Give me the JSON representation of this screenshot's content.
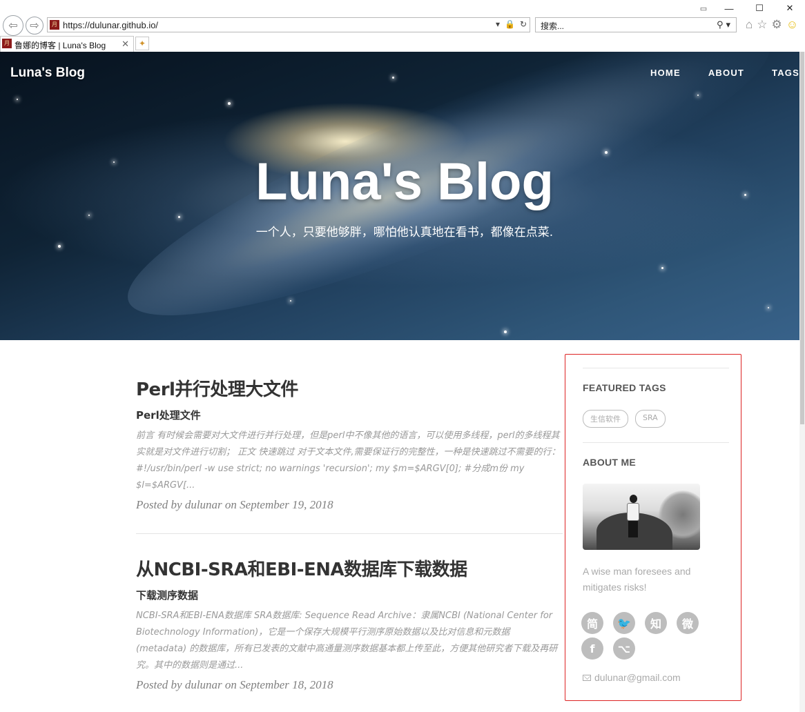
{
  "browser": {
    "url": "https://dulunar.github.io/",
    "search_placeholder": "搜索...",
    "tab_title": "鲁娜的博客 | Luna's Blog",
    "favicon_text": "月",
    "tab_close": "✕",
    "window_controls": {
      "minimize": "—",
      "maximize": "☐",
      "close": "✕"
    },
    "icons": [
      "back-icon",
      "forward-icon",
      "lock-icon",
      "refresh-icon",
      "search-icon",
      "home-icon",
      "star-icon",
      "gear-icon",
      "smiley-icon"
    ]
  },
  "header": {
    "brand": "Luna's Blog",
    "nav": [
      "HOME",
      "ABOUT",
      "TAGS"
    ],
    "title": "Luna's Blog",
    "subtitle": "一个人，只要他够胖，哪怕他认真地在看书，都像在点菜."
  },
  "posts": [
    {
      "title": "Perl并行处理大文件",
      "subtitle": "Perl处理文件",
      "excerpt": "前言 有时候会需要对大文件进行并行处理，但是perl中不像其他的语言，可以使用多线程，perl的多线程其实就是对文件进行切割； 正文 快速跳过 对于文本文件,需要保证行的完整性，一种是快速跳过不需要的行： #!/usr/bin/perl -w use strict; no warnings 'recursion'; my $m=$ARGV[0]; #分成m份 my $l=$ARGV[...",
      "meta": "Posted by dulunar on September 19, 2018"
    },
    {
      "title": "从NCBI-SRA和EBI-ENA数据库下载数据",
      "subtitle": "下载测序数据",
      "excerpt": "NCBI-SRA和EBI-ENA数据库 SRA数据库: Sequence Read Archive：隶属NCBI (National Center for Biotechnology Information)，它是一个保存大规模平行测序原始数据以及比对信息和元数据 (metadata) 的数据库，所有已发表的文献中高通量测序数据基本都上传至此，方便其他研究者下载及再研究。其中的数据则是通过...",
      "meta": "Posted by dulunar on September 18, 2018"
    }
  ],
  "sidebar": {
    "featured_tags_heading": "FEATURED TAGS",
    "tags": [
      "生信软件",
      "SRA"
    ],
    "about_heading": "ABOUT ME",
    "about_text": "A wise man foresees and mitigates risks!",
    "social": [
      {
        "name": "jianshu-icon",
        "glyph": "简"
      },
      {
        "name": "twitter-icon",
        "glyph": "🐦"
      },
      {
        "name": "zhihu-icon",
        "glyph": "知"
      },
      {
        "name": "weibo-icon",
        "glyph": "微"
      },
      {
        "name": "facebook-icon",
        "glyph": "f"
      },
      {
        "name": "github-icon",
        "glyph": "⌥"
      }
    ],
    "email": "dulunar@gmail.com"
  }
}
